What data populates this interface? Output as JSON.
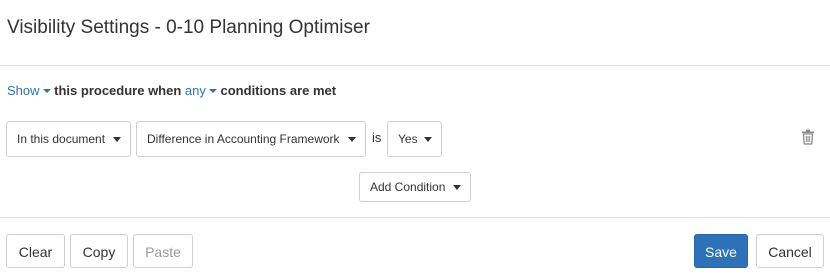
{
  "dialog": {
    "title": "Visibility Settings - 0-10 Planning Optimiser"
  },
  "rule": {
    "action": "Show",
    "middle_text": "this procedure when",
    "quantifier": "any",
    "end_text": "conditions are met"
  },
  "condition": {
    "scope": "In this document",
    "field": "Difference in Accounting Framework",
    "operator": "is",
    "value": "Yes",
    "delete_icon": "trash-icon"
  },
  "add_condition_label": "Add Condition",
  "footer": {
    "clear_label": "Clear",
    "copy_label": "Copy",
    "paste_label": "Paste",
    "save_label": "Save",
    "cancel_label": "Cancel"
  },
  "colors": {
    "primary": "#2d72b8",
    "link": "#2d72b8",
    "border": "#cfcfcf"
  }
}
